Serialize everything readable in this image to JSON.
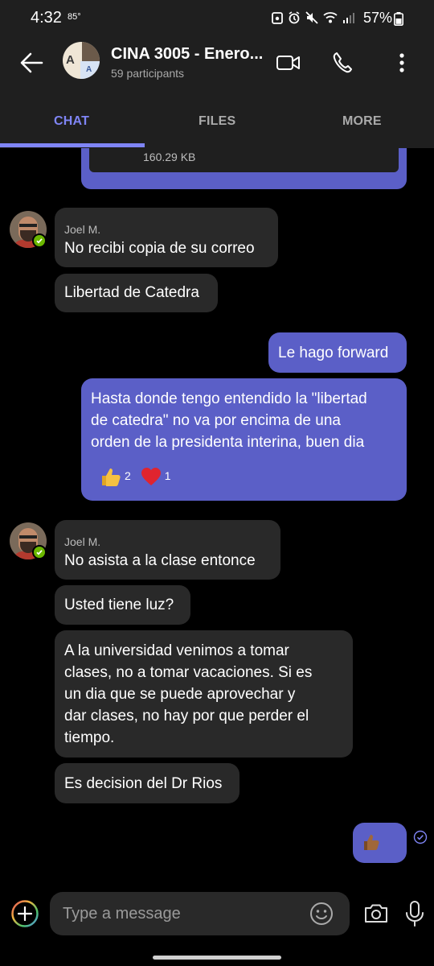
{
  "status_bar": {
    "time": "4:32",
    "temperature": "85°",
    "battery": "57%"
  },
  "header": {
    "title": "CINA 3005 - Enero...",
    "subtitle": "59 participants",
    "avatar_letters": [
      "A",
      "A"
    ]
  },
  "tabs": [
    {
      "label": "CHAT",
      "active": true
    },
    {
      "label": "FILES",
      "active": false
    },
    {
      "label": "MORE",
      "active": false
    }
  ],
  "file_card": {
    "size": "160.29 KB"
  },
  "messages": {
    "group1": {
      "sender": "Joel M.",
      "m1": "No recibi copia de su correo",
      "m2": "Libertad de Catedra"
    },
    "out1": "Le hago forward",
    "out2": {
      "line1": "Hasta donde tengo entendido la \"libertad",
      "line2": "de catedra\" no va por encima de una",
      "line3": "orden de la presidenta interina, buen dia",
      "reactions": [
        {
          "emoji": "thumbs-up",
          "count": "2"
        },
        {
          "emoji": "heart",
          "count": "1"
        }
      ]
    },
    "group2": {
      "sender": "Joel M.",
      "m1": "No asista a la clase entonce",
      "m2": "Usted tiene luz?",
      "m3": {
        "line1": "A la universidad venimos a tomar",
        "line2": "clases, no a tomar vacaciones. Si es",
        "line3": "un dia que se puede aprovechar y",
        "line4": "dar clases, no hay por que perder el",
        "line5": "tiempo."
      },
      "m4": "Es decision del Dr Rios"
    },
    "out3": {
      "emoji": "thumbs-up"
    }
  },
  "composer": {
    "placeholder": "Type a message"
  },
  "colors": {
    "accent": "#7f85f5",
    "outgoing_bubble": "#5b5fc7",
    "incoming_bubble": "#292929",
    "presence_available": "#6bb700"
  }
}
